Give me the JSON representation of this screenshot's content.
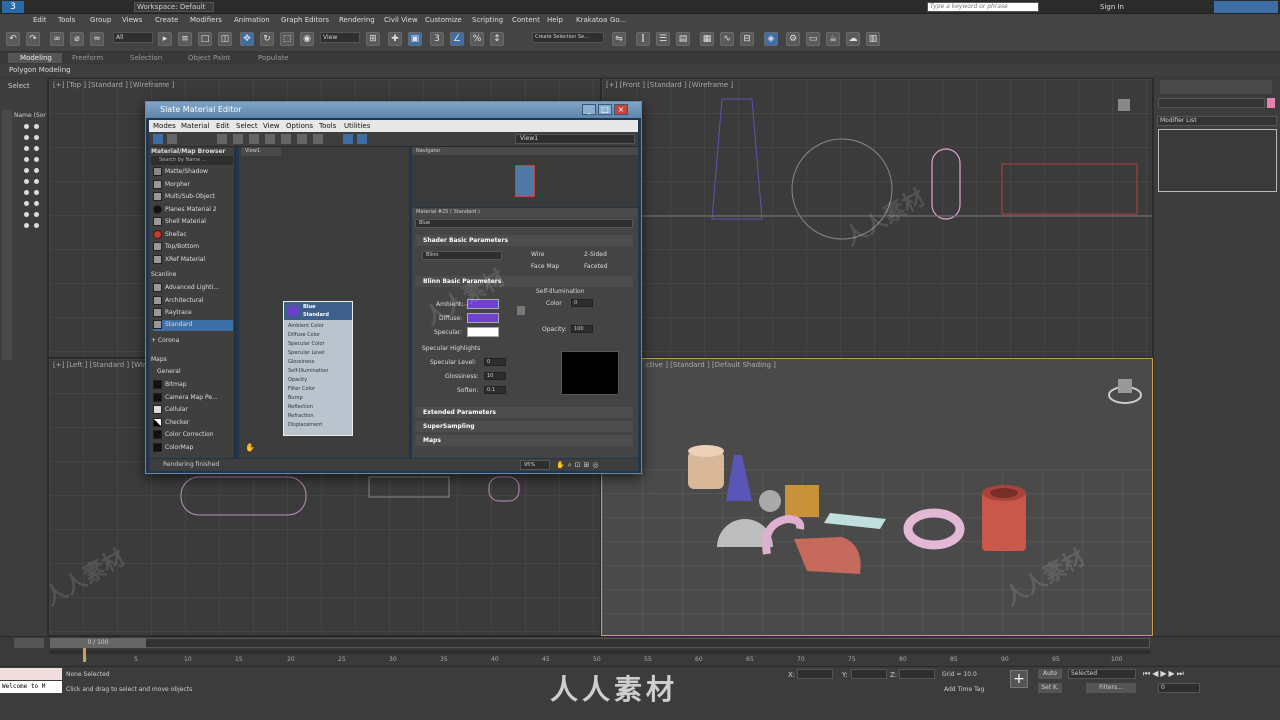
{
  "titlebar": {
    "workspace": "Workspace: Default",
    "search_placeholder": "Type a keyword or phrase",
    "sign_in": "Sign In"
  },
  "menu": [
    "Edit",
    "Tools",
    "Group",
    "Views",
    "Create",
    "Modifiers",
    "Animation",
    "Graph Editors",
    "Rendering",
    "Civil View",
    "Customize",
    "Scripting",
    "Content",
    "Help",
    "Krakatoa",
    "Go..."
  ],
  "toolbar": {
    "selection_filter": "All",
    "view_dropdown": "View",
    "selection_set": "Create Selection Se..."
  },
  "ribbon": {
    "tabs": [
      "Modeling",
      "Freeform",
      "Selection",
      "Object Paint",
      "Populate"
    ],
    "subtab": "Polygon Modeling"
  },
  "scene_explorer": {
    "select_label": "Select",
    "column": "Name (Sor"
  },
  "viewports": {
    "top": "[+] [Top ] [Standard ] [Wireframe ]",
    "front": "[+] [Front ] [Standard ] [Wireframe ]",
    "left": "[+] [Left ] [Standard ] [Wire",
    "persp": "ctive ] [Standard ] [Default Shading ]"
  },
  "command_panel": {
    "modifier_list": "Modifier List"
  },
  "sme": {
    "title": "Slate Material Editor",
    "menu": [
      "Modes",
      "Material",
      "Edit",
      "Select",
      "View",
      "Options",
      "Tools",
      "Utilities"
    ],
    "view_dropdown": "View1",
    "browser_title": "Material/Map Browser",
    "search": "Search by Name ...",
    "materials": [
      "Matte/Shadow",
      "Morpher",
      "Multi/Sub-Object",
      "Planes Material 2",
      "Shellac",
      "Shell Material",
      "Top/Bottom",
      "XRef Material"
    ],
    "scanline_head": "Scanline",
    "scanline": [
      "Advanced Lighti...",
      "Architectural",
      "Raytrace",
      "Standard"
    ],
    "corona": "+ Corona",
    "maps_head": "Maps",
    "general_head": "General",
    "maps": [
      "Bitmap",
      "Camera Map Pe...",
      "Cellular",
      "Checker",
      "Color Correction",
      "ColorMap"
    ],
    "view_tab": "View1",
    "node": {
      "name": "Blue",
      "type": "Standard",
      "slots": [
        "Ambient Color",
        "Diffuse Color",
        "Specular Color",
        "Specular Level",
        "Glossiness",
        "Self-Illumination",
        "Opacity",
        "Filter Color",
        "Bump",
        "Reflection",
        "Refraction",
        "Displacement"
      ]
    },
    "navigator": "Navigator",
    "param_title": "Material #25  ( Standard )",
    "mat_name": "Blue",
    "shader_hdr": "Shader Basic Parameters",
    "shader": "Blinn",
    "wire": "Wire",
    "two_sided": "2-Sided",
    "face_map": "Face Map",
    "faceted": "Faceted",
    "blinn_hdr": "Blinn Basic Parameters",
    "self_illum": "Self-Illumination",
    "color": "Color",
    "color_val": "0",
    "ambient": "Ambient:",
    "diffuse": "Diffuse:",
    "specular": "Specular:",
    "opacity": "Opacity:",
    "opacity_val": "100",
    "spec_hl": "Specular Highlights",
    "spec_level": "Specular Level:",
    "spec_level_val": "0",
    "gloss": "Glossiness:",
    "gloss_val": "10",
    "soften": "Soften:",
    "soften_val": "0.1",
    "extended": "Extended Parameters",
    "supersampling": "SuperSampling",
    "maps_roll": "Maps",
    "status": "Rendering finished",
    "zoom": "95%"
  },
  "timeline": {
    "frame": "0 / 100",
    "ticks": [
      "0",
      "5",
      "10",
      "15",
      "20",
      "25",
      "30",
      "35",
      "40",
      "45",
      "50",
      "55",
      "60",
      "65",
      "70",
      "75",
      "80",
      "85",
      "90",
      "95",
      "100"
    ]
  },
  "status": {
    "maxscript": "Welcome to M",
    "selected": "None Selected",
    "prompt": "Click and drag to select and move objects",
    "x": "X:",
    "y": "Y:",
    "z": "Z:",
    "grid": "Grid = 10.0",
    "add_time_tag": "Add Time Tag",
    "auto": "Auto",
    "set_k": "Set K.",
    "selected_dd": "Selected",
    "filters": "Filters...",
    "frame_field": "0"
  },
  "watermark": "人人素材",
  "colors": {
    "ambient": "#7040d0",
    "diffuse": "#7040d0",
    "specular": "#ffffff",
    "persp_border": "#c9a050"
  }
}
